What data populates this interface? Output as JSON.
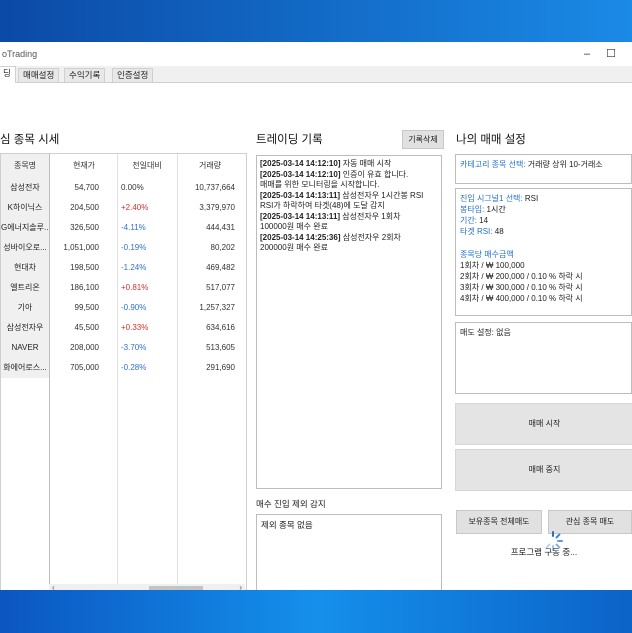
{
  "window": {
    "title": "oTrading"
  },
  "tabs": [
    {
      "label": "딩"
    },
    {
      "label": "매매설정"
    },
    {
      "label": "수익기록"
    },
    {
      "label": "인증설정"
    }
  ],
  "market": {
    "title": "심 종목 시세",
    "columns": [
      "종목명",
      "현재가",
      "전일대비",
      "거래량"
    ],
    "rows": [
      {
        "name": "삼성전자",
        "price": "54,700",
        "change": "0.00%",
        "volume": "10,737,664",
        "dir": "flat"
      },
      {
        "name": "K하이닉스",
        "price": "204,500",
        "change": "+2.40%",
        "volume": "3,379,970",
        "dir": "up"
      },
      {
        "name": "G에너지솔루...",
        "price": "326,500",
        "change": "-4.11%",
        "volume": "444,431",
        "dir": "down"
      },
      {
        "name": "성바이오로...",
        "price": "1,051,000",
        "change": "-0.19%",
        "volume": "80,202",
        "dir": "down"
      },
      {
        "name": "현대차",
        "price": "198,500",
        "change": "-1.24%",
        "volume": "469,482",
        "dir": "down"
      },
      {
        "name": "엘트리온",
        "price": "186,100",
        "change": "+0.81%",
        "volume": "517,077",
        "dir": "up"
      },
      {
        "name": "기아",
        "price": "99,500",
        "change": "-0.90%",
        "volume": "1,257,327",
        "dir": "down"
      },
      {
        "name": "삼성전자우",
        "price": "45,500",
        "change": "+0.33%",
        "volume": "634,616",
        "dir": "up"
      },
      {
        "name": "NAVER",
        "price": "208,000",
        "change": "-3.70%",
        "volume": "513,605",
        "dir": "down"
      },
      {
        "name": "화에어로스...",
        "price": "705,000",
        "change": "-0.28%",
        "volume": "291,690",
        "dir": "down"
      }
    ]
  },
  "trade_log": {
    "title": "트레이딩 기록",
    "clear_label": "기록삭제",
    "lines": [
      {
        "ts": "[2025-03-14  14:12:10]",
        "text": " 자동 매매 시작"
      },
      {
        "ts": "[2025-03-14  14:12:10]",
        "text": " 인증이 유효 합니다."
      },
      {
        "ts": "",
        "text": "매매를 위한 모니터링을 시작합니다."
      },
      {
        "ts": "[2025-03-14  14:13:11]",
        "text": " 삼성전자우 1시간봉 RSI"
      },
      {
        "ts": "",
        "text": "RSI가 하락하여 타겟(48)에 도달 감지"
      },
      {
        "ts": "[2025-03-14  14:13:11]",
        "text": " 삼성전자우 1회차"
      },
      {
        "ts": "",
        "text": "100000원 매수 완료"
      },
      {
        "ts": "[2025-03-14  14:25:36]",
        "text": " 삼성전자우 2회차"
      },
      {
        "ts": "",
        "text": "200000원 매수 완료"
      }
    ]
  },
  "exclusion": {
    "title": "매수 진입 제외 감지",
    "content": "제외 종목 없음"
  },
  "my_settings": {
    "title": "나의 매매 설정",
    "category_label": "카테고리 종목 선택:",
    "category_value": " 거래량 상위 10-거래소",
    "signal_label": "진입 시그널1 선택:",
    "signal_value": " RSI",
    "candle_label": "봉타입:",
    "candle_value": " 1시간",
    "period_label": "기간:",
    "period_value": " 14",
    "target_label": "타겟 RSI:",
    "target_value": " 48",
    "amount_title": "종목당 매수금액",
    "amounts": [
      "1회차 / ₩ 100,000",
      "2회차 / ₩ 200,000 / 0.10 % 하락 시",
      "3회차 / ₩ 300,000 / 0.10 % 하락 시",
      "4회차 / ₩ 400,000 / 0.10 % 하락 시"
    ],
    "sell_setting": "매도 설정: 없음",
    "start_label": "매매 시작",
    "stop_label": "매매 중지",
    "sell_all_label": "보유종목 전체매도",
    "interest_label": "관심 종목 매도",
    "status": "프로그램 구동 중..."
  },
  "colors": {
    "up": "#d9302c",
    "down": "#2f6fd6",
    "accent": "#1f6fd0"
  }
}
